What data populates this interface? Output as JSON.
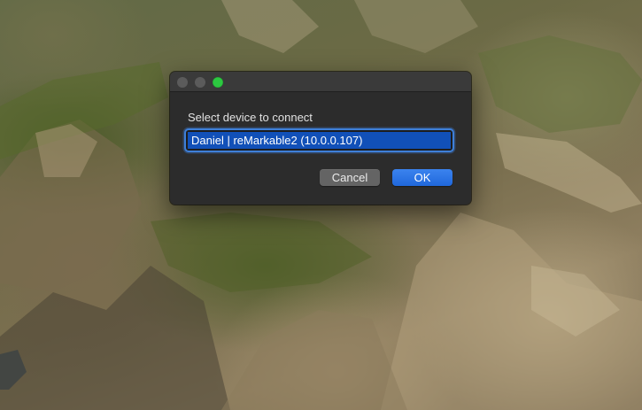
{
  "dialog": {
    "prompt": "Select device to connect",
    "selected_device": "Daniel | reMarkable2 (10.0.0.107)",
    "cancel_label": "Cancel",
    "ok_label": "OK"
  },
  "colors": {
    "accent": "#2b74e6",
    "selection": "#1150b8",
    "zoom_button": "#2cc840",
    "dialog_background": "#2c2c2c"
  }
}
